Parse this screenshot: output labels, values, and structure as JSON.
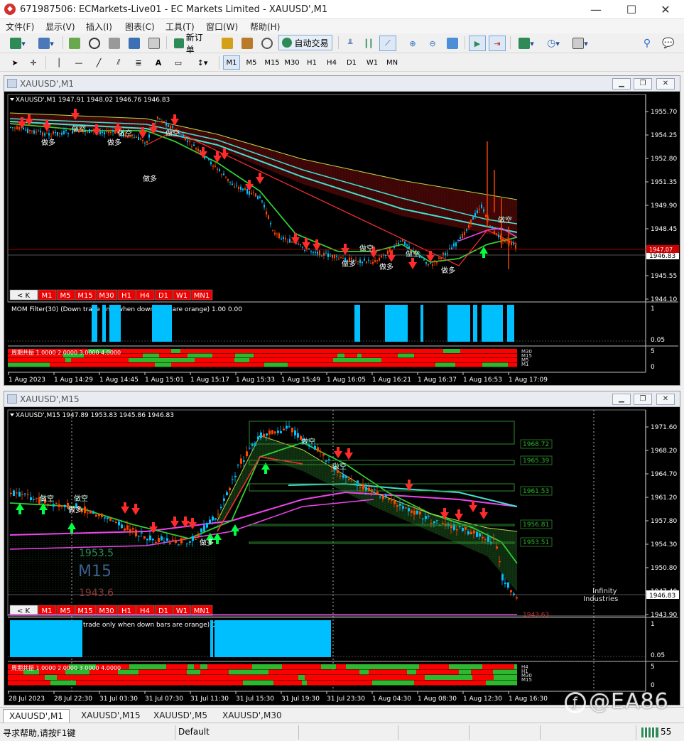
{
  "window": {
    "title": "671987506: ECMarkets-Live01 - EC Markets Limited - XAUUSD',M1",
    "minimize": "—",
    "maximize": "☐",
    "close": "✕"
  },
  "menu": [
    "文件(F)",
    "显示(V)",
    "插入(I)",
    "图表(C)",
    "工具(T)",
    "窗口(W)",
    "帮助(H)"
  ],
  "toolbar": {
    "new_order": "新订单",
    "auto_trading": "自动交易",
    "timeframes": [
      "M1",
      "M5",
      "M15",
      "M30",
      "H1",
      "H4",
      "D1",
      "W1",
      "MN"
    ],
    "active_timeframe": "M1"
  },
  "chart_top": {
    "window_caption": "XAUUSD',M1",
    "ohlc_label": "XAUUSD',M1  1947.91 1948.02 1946.76 1946.83",
    "price_ticks": [
      "1955.70",
      "1954.25",
      "1952.80",
      "1951.35",
      "1949.90",
      "1948.45",
      "1947.00",
      "1945.55",
      "1944.10"
    ],
    "current_price": "1946.83",
    "current_price_red": "1947.07",
    "tf_buttons": [
      "< K",
      "M1",
      "M5",
      "M15",
      "M30",
      "H1",
      "H4",
      "D1",
      "W1",
      "MN1"
    ],
    "signals": [
      "做多",
      "做空"
    ],
    "mom_label": "MOM Filter(30)  (Down trade only when down bars are orange) 1.00 0.00",
    "mom_ticks": [
      "1",
      "0.05"
    ],
    "resonance_label": "周期共振 1.0000 2.0000 3.0000 4.0000",
    "resonance_ticks": [
      "5",
      "0"
    ],
    "resonance_tags": [
      "M30",
      "M15",
      "M5",
      "M1"
    ],
    "time_ticks": [
      "1 Aug 2023",
      "1 Aug 14:29",
      "1 Aug 14:45",
      "1 Aug 15:01",
      "1 Aug 15:17",
      "1 Aug 15:33",
      "1 Aug 15:49",
      "1 Aug 16:05",
      "1 Aug 16:21",
      "1 Aug 16:37",
      "1 Aug 16:53",
      "1 Aug 17:09"
    ]
  },
  "chart_bottom": {
    "window_caption": "XAUUSD',M15",
    "ohlc_label": "XAUUSD',M15  1947.89 1953.83 1945.86 1946.83",
    "price_ticks": [
      "1971.60",
      "1968.20",
      "1964.70",
      "1961.20",
      "1957.80",
      "1954.30",
      "1950.80",
      "1947.40",
      "1943.90"
    ],
    "current_price": "1946.83",
    "level_labels": [
      "1968.72",
      "1965.39",
      "1961.53",
      "1956.81",
      "1953.51",
      "1943.63"
    ],
    "tf_buttons": [
      "< K",
      "M1",
      "M5",
      "M15",
      "M30",
      "H1",
      "H4",
      "D1",
      "W1",
      "MN1"
    ],
    "stamp_high": "1953.5",
    "stamp_tf": "M15",
    "stamp_low": "1943.6",
    "brand_line1": "Infinity",
    "brand_line2": "Industries",
    "signals": [
      "做多",
      "做空"
    ],
    "mom_label": "MOM Filter(30)  (Down trade only when down bars are orange) 0.00 -1.00",
    "mom_ticks": [
      "1",
      "0.05"
    ],
    "resonance_label": "周期共振 1.0000 2.0000 3.0000 4.0000",
    "resonance_ticks": [
      "5",
      "0"
    ],
    "resonance_tags": [
      "H4",
      "H1",
      "M30",
      "M15"
    ],
    "time_ticks": [
      "28 Jul 2023",
      "28 Jul 22:30",
      "31 Jul 03:30",
      "31 Jul 07:30",
      "31 Jul 11:30",
      "31 Jul 15:30",
      "31 Jul 19:30",
      "31 Jul 23:30",
      "1 Aug 04:30",
      "1 Aug 08:30",
      "1 Aug 12:30",
      "1 Aug 16:30"
    ]
  },
  "tabs": [
    "XAUUSD',M1",
    "XAUUSD',M15",
    "XAUUSD',M5",
    "XAUUSD',M30"
  ],
  "active_tab": "XAUUSD',M1",
  "status": {
    "hint": "寻求帮助,请按F1键",
    "profile": "Default",
    "connection_value": "55"
  },
  "watermark": "@EA86",
  "colors": {
    "bull_candle": "#ff4500",
    "bear_candle": "#00bfff",
    "ma_green": "#32cd32",
    "ma_cyan": "#40e0d0",
    "ma_magenta": "#ee44ee",
    "arrow_down": "#ff2a2a",
    "arrow_up": "#00ff40",
    "mom_bar": "#00bfff",
    "resonance_red": "#ff0000",
    "resonance_green": "#2eb82e"
  }
}
